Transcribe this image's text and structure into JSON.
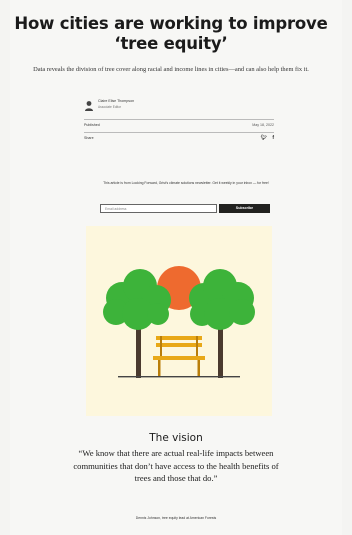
{
  "article": {
    "title": "How cities are working to improve ‘tree equity’",
    "dek": "Data reveals the division of tree cover along racial and income lines in cities—and can also help them fix it."
  },
  "byline": {
    "author": "Claire Elise Thompson",
    "role": "Associate Editor"
  },
  "meta": {
    "published_label": "Published",
    "published_date": "May 18, 2022",
    "share_label": "Share",
    "share_icons": [
      "twitter-icon",
      "facebook-icon"
    ]
  },
  "newsletter": {
    "text": "This article is from Looking Forward, Grist's climate solutions newsletter. Get it weekly in your inbox — for free!",
    "email_placeholder": "Email address",
    "subscribe_label": "Subscribe"
  },
  "illustration": {
    "colors": {
      "background": "#fdf7dd",
      "sun": "#ee6a2f",
      "foliage": "#3db33a",
      "foliage_dark": "#2e8f2f",
      "trunk": "#4a3a2e",
      "bench": "#e8a817",
      "bench_dark": "#b97e0a",
      "ground": "#444"
    }
  },
  "section": {
    "heading": "The vision",
    "quote": "“We know that there are actual real-life impacts between communities that don’t have access to the health benefits of trees and those that do.”",
    "attribution": "Dennis Johnson, tree equity lead at American Forests"
  }
}
